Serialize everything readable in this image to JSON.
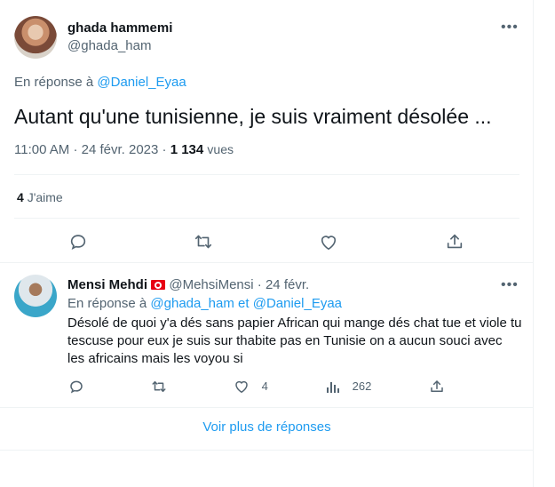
{
  "main_tweet": {
    "author_name": "ghada hammemi",
    "author_handle": "@ghada_ham",
    "reply_prefix": "En réponse à",
    "reply_to": "@Daniel_Eyaa",
    "text": "Autant qu'une tunisienne, je suis vraiment désolée ...",
    "time": "11:00 AM",
    "sep1": "·",
    "date": "24 févr. 2023",
    "sep2": "·",
    "views_count": "1 134",
    "views_label": "vues",
    "likes_count": "4",
    "likes_label": "J'aime"
  },
  "reply": {
    "author_name": "Mensi Mehdi",
    "author_handle": "@MehsiMensi",
    "sep": "·",
    "date": "24 févr.",
    "reply_prefix": "En réponse à",
    "reply_to_1": "@ghada_ham",
    "reply_and": "et",
    "reply_to_2": "@Daniel_Eyaa",
    "text": "Désolé de quoi y'a dés sans papier African qui mange dés chat tue et viole tu tescuse pour eux je suis sur thabite pas en Tunisie on a aucun souci avec les africains mais les voyou si",
    "likes": "4",
    "views": "262"
  },
  "show_more": "Voir plus de réponses",
  "colors": {
    "accent": "#1d9bf0",
    "muted": "#536471",
    "text": "#0f1419",
    "border": "#eff3f4"
  }
}
